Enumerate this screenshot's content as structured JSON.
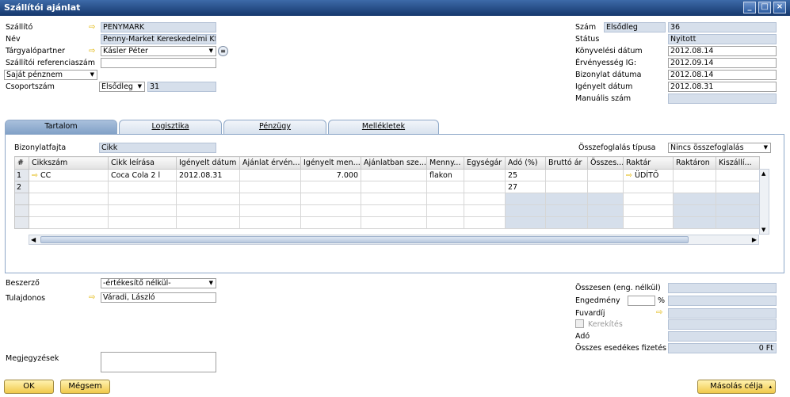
{
  "window": {
    "title": "Szállítói ajánlat",
    "controls": [
      "_",
      "□",
      "×"
    ]
  },
  "header": {
    "vendor_label": "Szállító",
    "vendor_value": "PENYMARK",
    "name_label": "Név",
    "name_value": "Penny-Market Kereskedelmi Kft.",
    "contact_label": "Tárgyalópartner",
    "contact_value": "Kásler Péter",
    "vendor_ref_label": "Szállítói referenciaszám",
    "vendor_ref_value": "",
    "currency_value": "Saját pénznem",
    "group_label": "Csoportszám",
    "group_series": "Elsődleg",
    "group_value": "31"
  },
  "doc": {
    "number_label": "Szám",
    "number_series": "Elsődleg",
    "number_value": "36",
    "status_label": "Státus",
    "status_value": "Nyitott",
    "posting_label": "Könyvelési dátum",
    "posting_value": "2012.08.14",
    "valid_label": "Érvényesség IG:",
    "valid_value": "2012.09.14",
    "docdate_label": "Bizonylat dátuma",
    "docdate_value": "2012.08.14",
    "required_label": "Igényelt dátum",
    "required_value": "2012.08.31",
    "manual_label": "Manuális szám",
    "manual_value": ""
  },
  "tabs": [
    "Tartalom",
    "Logisztika",
    "Pénzügy",
    "Mellékletek"
  ],
  "content": {
    "doctype_label": "Bizonylatfajta",
    "doctype_value": "Cikk",
    "summary_label": "Összefoglalás típusa",
    "summary_value": "Nincs összefoglalás"
  },
  "grid": {
    "columns": [
      "#",
      "Cikkszám",
      "Cikk leírása",
      "Igényelt dátum",
      "Ajánlat érvén...",
      "Igényelt men...",
      "Ajánlatban sze...",
      "Menny...",
      "Egységár",
      "Adó (%)",
      "Bruttó ár",
      "Összes...",
      "Raktár",
      "Raktáron",
      "Kiszállí..."
    ],
    "rows": [
      [
        "1",
        "CC",
        "Coca Cola 2 l",
        "2012.08.31",
        "",
        "7.000",
        "",
        "flakon",
        "",
        "25",
        "",
        "",
        "ÜDÍTŐ",
        "",
        ""
      ],
      [
        "2",
        "",
        "",
        "",
        "",
        "",
        "",
        "",
        "",
        "27",
        "",
        "",
        "",
        "",
        ""
      ],
      [
        "",
        "",
        "",
        "",
        "",
        "",
        "",
        "",
        "",
        "",
        "",
        "",
        "",
        "",
        ""
      ],
      [
        "",
        "",
        "",
        "",
        "",
        "",
        "",
        "",
        "",
        "",
        "",
        "",
        "",
        "",
        ""
      ],
      [
        "",
        "",
        "",
        "",
        "",
        "",
        "",
        "",
        "",
        "",
        "",
        "",
        "",
        "",
        ""
      ]
    ]
  },
  "footer": {
    "buyer_label": "Beszerző",
    "buyer_value": "-értékesítő nélkül-",
    "owner_label": "Tulajdonos",
    "owner_value": "Váradi, László",
    "remarks_label": "Megjegyzések",
    "total_before_label": "Összesen (eng. nélkül)",
    "discount_label": "Engedmény",
    "discount_pct": "%",
    "freight_label": "Fuvardíj",
    "rounding_label": "Kerekítés",
    "tax_label": "Adó",
    "total_due_label": "Összes esedékes fizetés",
    "total_due_value": "0 Ft"
  },
  "buttons": {
    "ok": "OK",
    "cancel": "Mégsem",
    "copy_to": "Másolás célja"
  }
}
